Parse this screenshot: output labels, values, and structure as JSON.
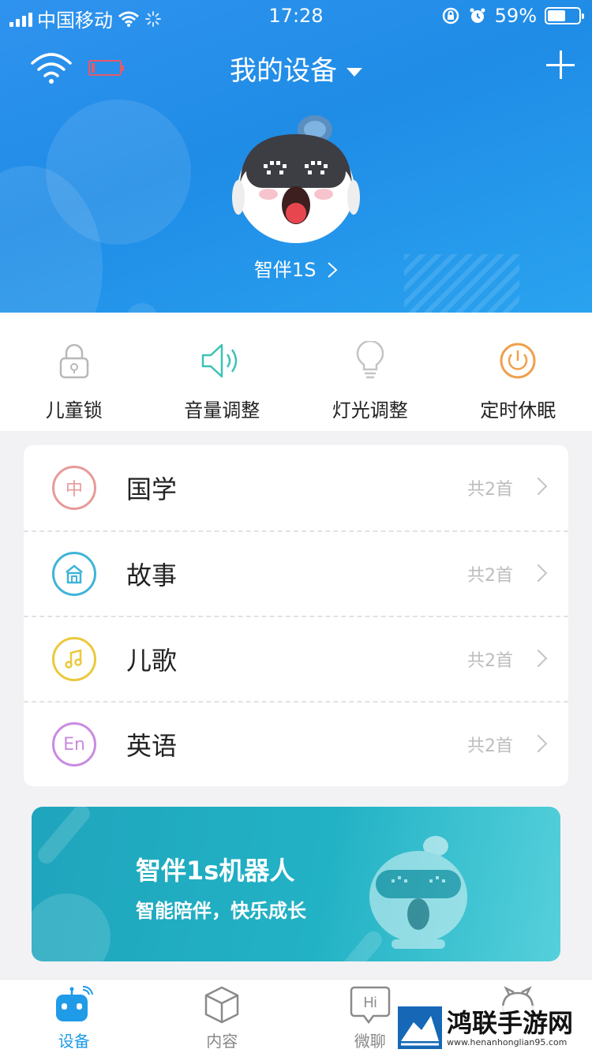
{
  "status_bar": {
    "carrier": "中国移动",
    "time": "17:28",
    "battery_percent": "59%",
    "battery_level": 0.59
  },
  "header": {
    "title": "我的设备",
    "device_name": "智伴1S",
    "device_battery_level": 0.1,
    "colors": {
      "background": "#1f8ce6",
      "low_battery": "#e8596a"
    }
  },
  "controls": [
    {
      "label": "儿童锁",
      "icon": "lock-icon"
    },
    {
      "label": "音量调整",
      "icon": "speaker-icon"
    },
    {
      "label": "灯光调整",
      "icon": "bulb-icon"
    },
    {
      "label": "定时休眠",
      "icon": "power-icon"
    }
  ],
  "categories": [
    {
      "badge": "中",
      "name": "国学",
      "count": "共2首",
      "icon": "chinese-icon",
      "color": "#e89a9a"
    },
    {
      "badge": "",
      "name": "故事",
      "count": "共2首",
      "icon": "house-icon",
      "color": "#3fb4d8"
    },
    {
      "badge": "",
      "name": "儿歌",
      "count": "共2首",
      "icon": "music-note-icon",
      "color": "#ecc83c"
    },
    {
      "badge": "En",
      "name": "英语",
      "count": "共2首",
      "icon": "english-icon",
      "color": "#c98be0"
    }
  ],
  "banner": {
    "title": "智伴1s机器人",
    "subtitle": "智能陪伴，快乐成长"
  },
  "tabbar": [
    {
      "label": "设备",
      "icon": "robot-icon",
      "active": true
    },
    {
      "label": "内容",
      "icon": "box-icon",
      "active": false
    },
    {
      "label": "微聊",
      "icon": "chat-hi-icon",
      "active": false
    },
    {
      "label": "",
      "icon": "profile-icon",
      "active": false
    }
  ],
  "chat_icon_text": "Hi",
  "watermark": {
    "title": "鸿联手游网",
    "url": "www.henanhonglian95.com"
  }
}
